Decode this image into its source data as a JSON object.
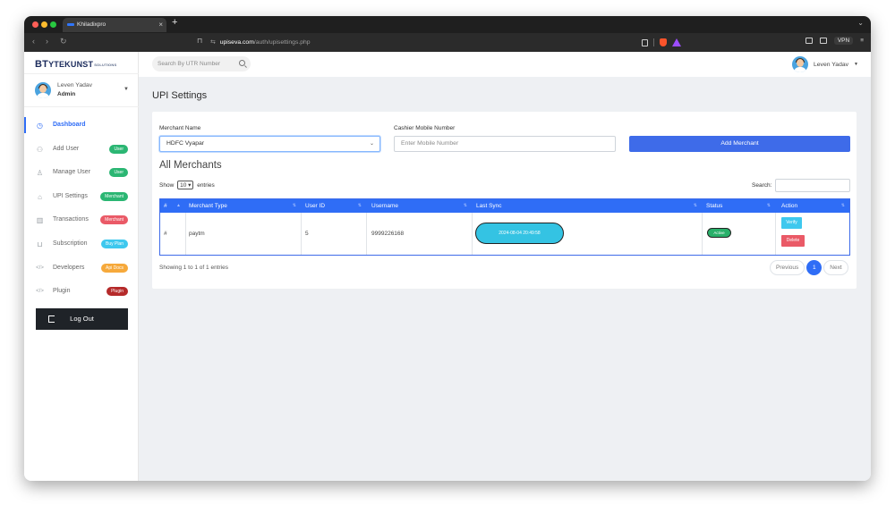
{
  "browser": {
    "tab_title": "Khiladixpro",
    "tab_close": "×",
    "new_tab": "+",
    "url_host": "upiseva.com",
    "url_path": "/auth/upisettings.php",
    "vpn_label": "VPN"
  },
  "sidebar": {
    "logo_big": "BT",
    "logo_text": "YTEKUNST",
    "logo_small": "SOLUTIONS",
    "user_name": "Leven Yadav",
    "user_role": "Admin",
    "items": [
      {
        "label": "Dashboard",
        "icon": "dashboard-icon",
        "glyph": "◷",
        "active": true
      },
      {
        "label": "Add User",
        "icon": "add-user-icon",
        "glyph": "⚇",
        "badge": "User",
        "badge_color": "#2bb673"
      },
      {
        "label": "Manage User",
        "icon": "manage-user-icon",
        "glyph": "♙",
        "badge": "User",
        "badge_color": "#2bb673"
      },
      {
        "label": "UPI Settings",
        "icon": "bank-icon",
        "glyph": "⌂",
        "badge": "Merchant",
        "badge_color": "#2bb673"
      },
      {
        "label": "Transactions",
        "icon": "transactions-icon",
        "glyph": "▥",
        "badge": "Merchant",
        "badge_color": "#ea5a67"
      },
      {
        "label": "Subscription",
        "icon": "cart-icon",
        "glyph": "⊔",
        "badge": "Buy Plan",
        "badge_color": "#3ec8ee"
      },
      {
        "label": "Developers",
        "icon": "code-icon",
        "glyph": "</>",
        "badge": "Api Docs",
        "badge_color": "#f6a93b"
      },
      {
        "label": "Plugin",
        "icon": "code-icon",
        "glyph": "</>",
        "badge": "Plugin",
        "badge_color": "#b52a2a"
      }
    ],
    "logout_label": "Log Out"
  },
  "topbar": {
    "search_placeholder": "Search By UTR Number",
    "user_name": "Leven Yadav"
  },
  "main": {
    "title": "UPI Settings",
    "form": {
      "merchant_label": "Merchant Name",
      "merchant_value": "HDFC Vyapar",
      "mobile_label": "Cashier Mobile Number",
      "mobile_placeholder": "Enter Mobile Number",
      "add_button": "Add Merchant"
    },
    "list_title": "All Merchants",
    "show_prefix": "Show",
    "show_value": "10",
    "show_suffix": "entries",
    "search_label": "Search:",
    "columns": [
      "#",
      "Merchant Type",
      "User ID",
      "Username",
      "Last Sync",
      "Status",
      "Action"
    ],
    "rows": [
      {
        "index": "#",
        "merchant_type": "paytm",
        "user_id": "5",
        "username": "9999226168",
        "last_sync": "2024-08-04 20:49:58",
        "status": "Active",
        "verify": "Verify",
        "delete": "Delete"
      }
    ],
    "entries_info": "Showing 1 to 1 of 1 entries",
    "pagination": {
      "prev": "Previous",
      "page": "1",
      "next": "Next"
    }
  },
  "colors": {
    "accent": "#2f6df6",
    "button": "#3e6be9",
    "sync": "#34c3e3",
    "active": "#29b06a",
    "delete": "#ea5a67"
  }
}
